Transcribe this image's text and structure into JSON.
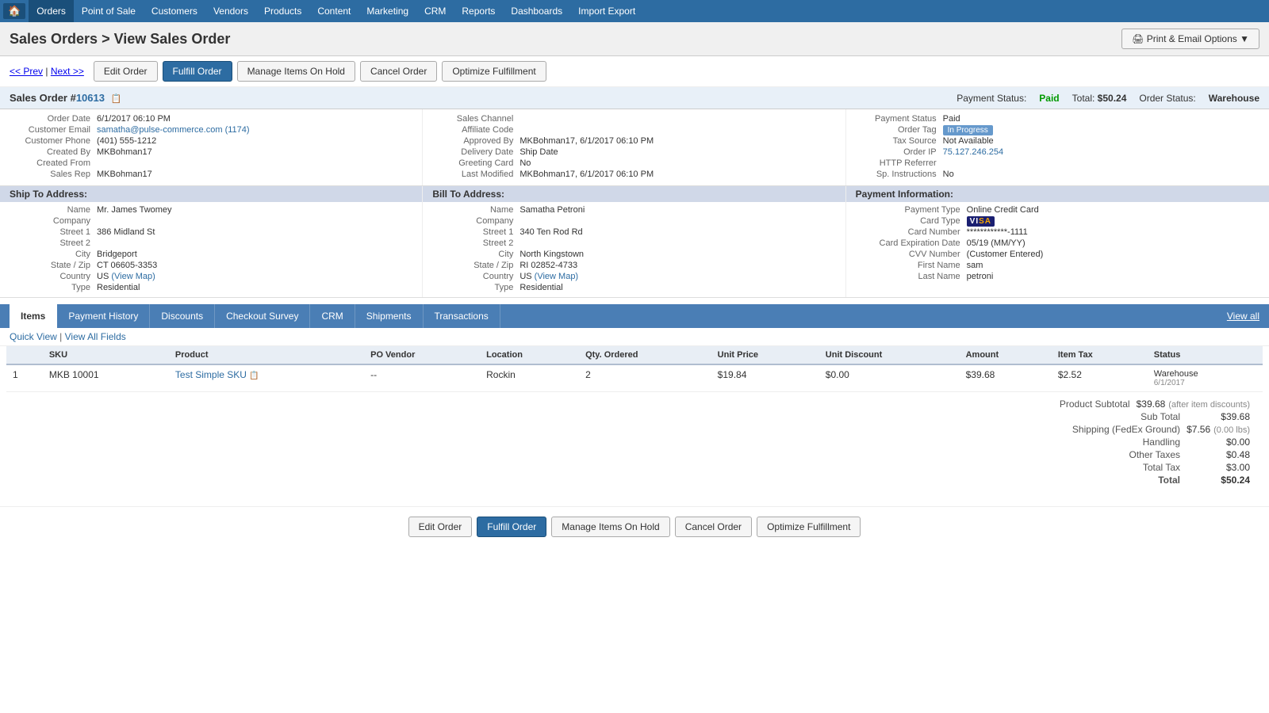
{
  "nav": {
    "home_icon": "🏠",
    "items": [
      {
        "label": "Orders",
        "active": true
      },
      {
        "label": "Point of Sale"
      },
      {
        "label": "Customers"
      },
      {
        "label": "Vendors"
      },
      {
        "label": "Products"
      },
      {
        "label": "Content"
      },
      {
        "label": "Marketing"
      },
      {
        "label": "CRM"
      },
      {
        "label": "Reports"
      },
      {
        "label": "Dashboards"
      },
      {
        "label": "Import Export"
      }
    ]
  },
  "header": {
    "title": "Sales Orders > View Sales Order",
    "print_email_label": "🖨 Print & Email Options ▼"
  },
  "breadcrumb": {
    "prev": "<< Prev",
    "next": "Next >>"
  },
  "action_buttons": {
    "edit_order": "Edit Order",
    "fulfill_order": "Fulfill Order",
    "manage_items_on_hold": "Manage Items On Hold",
    "cancel_order": "Cancel Order",
    "optimize_fulfillment": "Optimize Fulfillment"
  },
  "order": {
    "title": "Sales Order #",
    "number": "10613",
    "payment_status_label": "Payment Status:",
    "payment_status_value": "Paid",
    "total_label": "Total:",
    "total_value": "$50.24",
    "order_status_label": "Order Status:",
    "order_status_value": "Warehouse"
  },
  "order_details": {
    "order_date_label": "Order Date",
    "order_date_value": "6/1/2017 06:10 PM",
    "customer_email_label": "Customer Email",
    "customer_email_value": "samatha@pulse-commerce.com",
    "customer_email_link": "(1174)",
    "customer_phone_label": "Customer Phone",
    "customer_phone_value": "(401) 555-1212",
    "created_by_label": "Created By",
    "created_by_value": "MKBohman17",
    "created_from_label": "Created From",
    "created_from_value": "",
    "sales_rep_label": "Sales Rep",
    "sales_rep_value": "MKBohman17",
    "sales_channel_label": "Sales Channel",
    "sales_channel_value": "",
    "affiliate_code_label": "Affiliate Code",
    "affiliate_code_value": "",
    "approved_by_label": "Approved By",
    "approved_by_value": "MKBohman17, 6/1/2017 06:10 PM",
    "delivery_date_label": "Delivery Date",
    "delivery_date_value": "Ship Date",
    "greeting_card_label": "Greeting Card",
    "greeting_card_value": "No",
    "last_modified_label": "Last Modified",
    "last_modified_value": "MKBohman17, 6/1/2017 06:10 PM",
    "payment_status_label2": "Payment Status",
    "payment_status_value2": "Paid",
    "order_tag_label": "Order Tag",
    "order_tag_value": "In Progress",
    "tax_source_label": "Tax Source",
    "tax_source_value": "Not Available",
    "order_ip_label": "Order IP",
    "order_ip_value": "75.127.246.254",
    "http_referrer_label": "HTTP Referrer",
    "http_referrer_value": "",
    "sp_instructions_label": "Sp. Instructions",
    "sp_instructions_value": "No"
  },
  "ship_to": {
    "header": "Ship To Address:",
    "name_label": "Name",
    "name_value": "Mr. James Twomey",
    "company_label": "Company",
    "company_value": "",
    "street1_label": "Street 1",
    "street1_value": "386 Midland St",
    "street2_label": "Street 2",
    "street2_value": "",
    "city_label": "City",
    "city_value": "Bridgeport",
    "state_zip_label": "State / Zip",
    "state_zip_value": "CT 06605-3353",
    "country_label": "Country",
    "country_value": "US",
    "country_link": "(View Map)",
    "type_label": "Type",
    "type_value": "Residential"
  },
  "bill_to": {
    "header": "Bill To Address:",
    "name_label": "Name",
    "name_value": "Samatha Petroni",
    "company_label": "Company",
    "company_value": "",
    "street1_label": "Street 1",
    "street1_value": "340 Ten Rod Rd",
    "street2_label": "Street 2",
    "street2_value": "",
    "city_label": "City",
    "city_value": "North Kingstown",
    "state_zip_label": "State / Zip",
    "state_zip_value": "RI 02852-4733",
    "country_label": "Country",
    "country_value": "US",
    "country_link": "(View Map)",
    "type_label": "Type",
    "type_value": "Residential"
  },
  "payment_info": {
    "header": "Payment Information:",
    "payment_type_label": "Payment Type",
    "payment_type_value": "Online Credit Card",
    "card_type_label": "Card Type",
    "card_type_value": "VISA",
    "card_number_label": "Card Number",
    "card_number_value": "************-1111",
    "card_expiry_label": "Card Expiration Date",
    "card_expiry_value": "05/19 (MM/YY)",
    "cvv_label": "CVV Number",
    "cvv_value": "(Customer Entered)",
    "first_name_label": "First Name",
    "first_name_value": "sam",
    "last_name_label": "Last Name",
    "last_name_value": "petroni"
  },
  "tabs": [
    {
      "label": "Items",
      "active": true
    },
    {
      "label": "Payment History"
    },
    {
      "label": "Discounts"
    },
    {
      "label": "Checkout Survey"
    },
    {
      "label": "CRM"
    },
    {
      "label": "Shipments"
    },
    {
      "label": "Transactions"
    }
  ],
  "view_all_label": "View all",
  "quick_view": {
    "label": "Quick View",
    "separator": "|",
    "view_all_fields": "View All Fields"
  },
  "table": {
    "headers": [
      "",
      "SKU",
      "Product",
      "PO Vendor",
      "Location",
      "Qty. Ordered",
      "Unit Price",
      "Unit Discount",
      "Amount",
      "Item Tax",
      "Status"
    ],
    "rows": [
      {
        "num": "1",
        "sku": "MKB 10001",
        "product": "Test Simple SKU",
        "po_vendor": "--",
        "location": "Rockin",
        "qty": "2",
        "unit_price": "$19.84",
        "unit_discount": "$0.00",
        "amount": "$39.68",
        "item_tax": "$2.52",
        "status": "Warehouse",
        "status_date": "6/1/2017"
      }
    ]
  },
  "totals": {
    "product_subtotal_label": "Product Subtotal",
    "product_subtotal_value": "$39.68",
    "product_subtotal_note": "(after item discounts)",
    "subtotal_label": "Sub Total",
    "subtotal_value": "$39.68",
    "shipping_label": "Shipping (FedEx Ground)",
    "shipping_value": "$7.56",
    "shipping_note": "(0.00 lbs)",
    "handling_label": "Handling",
    "handling_value": "$0.00",
    "other_taxes_label": "Other Taxes",
    "other_taxes_value": "$0.48",
    "total_tax_label": "Total Tax",
    "total_tax_value": "$3.00",
    "total_label": "Total",
    "total_value": "$50.24"
  },
  "bottom_buttons": {
    "edit_order": "Edit Order",
    "fulfill_order": "Fulfill Order",
    "manage_items_on_hold": "Manage Items On Hold",
    "cancel_order": "Cancel Order",
    "optimize_fulfillment": "Optimize Fulfillment"
  }
}
